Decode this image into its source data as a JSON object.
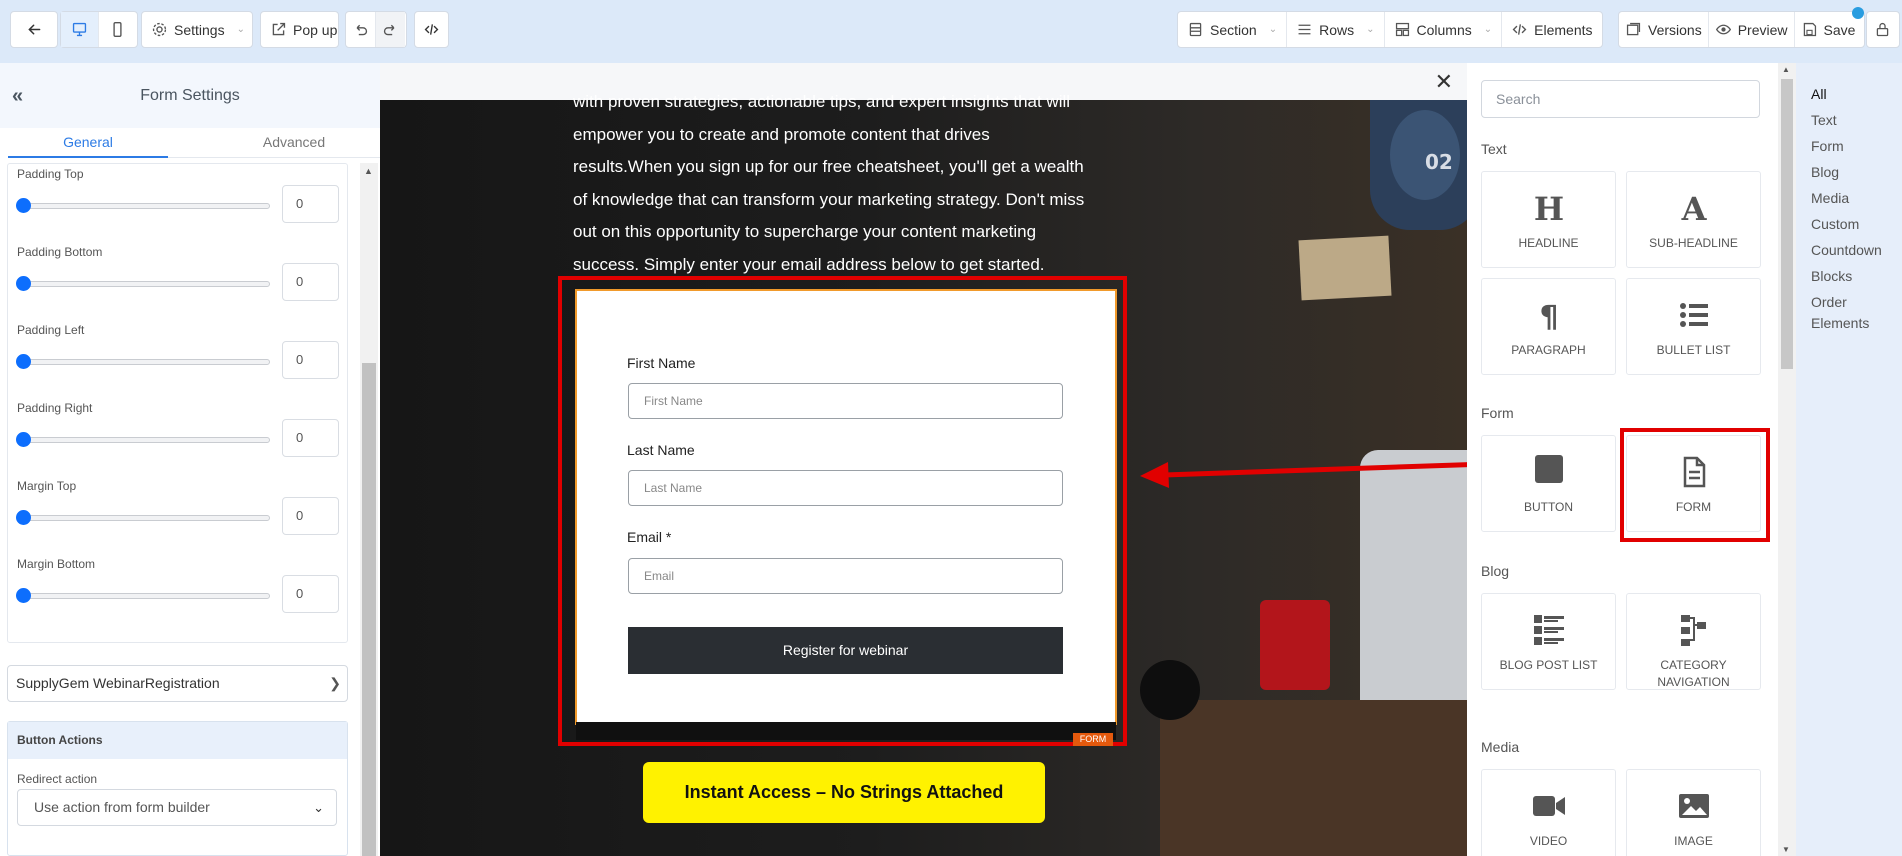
{
  "toolbar": {
    "settings_label": "Settings",
    "popup_label": "Pop up",
    "section_label": "Section",
    "rows_label": "Rows",
    "columns_label": "Columns",
    "elements_label": "Elements",
    "versions_label": "Versions",
    "preview_label": "Preview",
    "save_label": "Save"
  },
  "left_panel": {
    "title": "Form Settings",
    "tabs": [
      "General",
      "Advanced"
    ],
    "active_tab": "General",
    "sliders": [
      {
        "label": "Padding Top",
        "value": "0"
      },
      {
        "label": "Padding Bottom",
        "value": "0"
      },
      {
        "label": "Padding Left",
        "value": "0"
      },
      {
        "label": "Padding Right",
        "value": "0"
      },
      {
        "label": "Margin Top",
        "value": "0"
      },
      {
        "label": "Margin Bottom",
        "value": "0"
      }
    ],
    "form_select": "SupplyGem WebinarRegistration",
    "button_actions": {
      "title": "Button Actions",
      "redirect_label": "Redirect action",
      "redirect_value": "Use action from form builder"
    }
  },
  "canvas": {
    "text_lines": [
      "with proven strategies, actionable tips, and expert insights that will",
      "empower you to create and promote content that drives",
      "results.When you sign up for our free cheatsheet, you'll get a wealth",
      "of knowledge that can transform your marketing strategy. Don't miss",
      "out on this opportunity to supercharge your content marketing",
      "success. Simply enter your email address below to get started."
    ],
    "form": {
      "first_name_label": "First Name",
      "first_name_placeholder": "First Name",
      "last_name_label": "Last Name",
      "last_name_placeholder": "Last Name",
      "email_label": "Email *",
      "email_placeholder": "Email",
      "submit_label": "Register for webinar",
      "tag": "FORM"
    },
    "cta_label": "Instant Access – No Strings Attached",
    "photo_badge": "02"
  },
  "right_panel": {
    "search_placeholder": "Search",
    "sections": {
      "text": {
        "title": "Text",
        "items": [
          {
            "label": "HEADLINE",
            "icon": "headline-icon"
          },
          {
            "label": "SUB-HEADLINE",
            "icon": "sub-headline-icon"
          },
          {
            "label": "PARAGRAPH",
            "icon": "paragraph-icon"
          },
          {
            "label": "BULLET LIST",
            "icon": "bullet-list-icon"
          }
        ]
      },
      "form": {
        "title": "Form",
        "items": [
          {
            "label": "BUTTON",
            "icon": "button-icon"
          },
          {
            "label": "FORM",
            "icon": "form-icon"
          }
        ]
      },
      "blog": {
        "title": "Blog",
        "items": [
          {
            "label": "BLOG POST LIST",
            "icon": "blog-post-list-icon"
          },
          {
            "label": "CATEGORY NAVIGATION",
            "icon": "category-navigation-icon"
          }
        ]
      },
      "media": {
        "title": "Media",
        "items": [
          {
            "label": "VIDEO",
            "icon": "video-icon"
          },
          {
            "label": "IMAGE",
            "icon": "image-icon"
          }
        ]
      }
    }
  },
  "categories": [
    "All",
    "Text",
    "Form",
    "Blog",
    "Media",
    "Custom",
    "Countdown",
    "Blocks",
    "Order Elements"
  ],
  "active_category": "All",
  "colors": {
    "accent": "#2c7be5",
    "slider_knob": "#0d6efd",
    "highlight": "#e10000",
    "cta_bg": "#fff200",
    "submit_bg": "#2a2e33",
    "form_tag_bg": "#e4590d"
  }
}
